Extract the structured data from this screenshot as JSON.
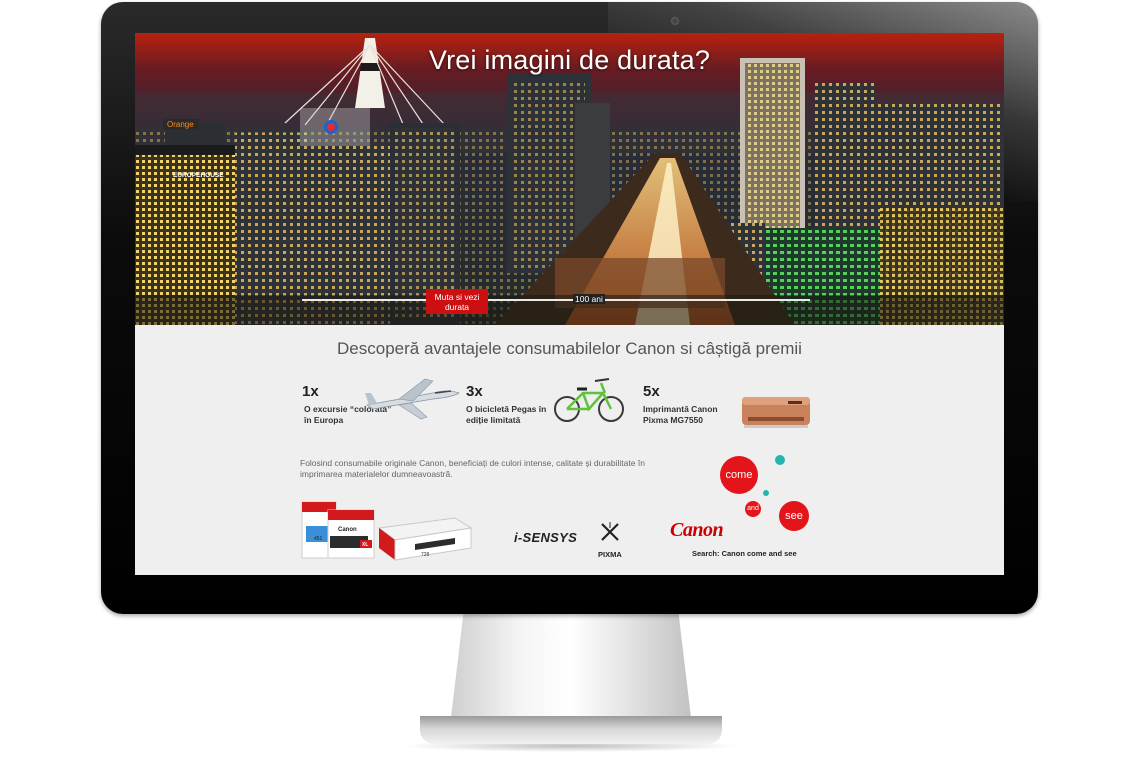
{
  "hero": {
    "title": "Vrei imagini de durata?",
    "slider_handle_label": "Muta si vezi durata",
    "slider_end_label": "100 ani",
    "sign_orange": "Orange",
    "sign_europe": "EUROPEHOUSE"
  },
  "promo": {
    "headline": "Descoperă avantajele consumabilelor Canon si câștigă premii",
    "prizes": [
      {
        "qty": "1x",
        "desc": "O excursie “colorată” în Europa"
      },
      {
        "qty": "3x",
        "desc": "O bicicletă Pegas în ediție limitată"
      },
      {
        "qty": "5x",
        "desc": "Imprimantă Canon Pixma MG7550"
      }
    ],
    "body": "Folosind consumabile originale Canon, beneficiați de culori intense, calitate și durabilitate în imprimarea materialelor dumneavoastră.",
    "brand_isensys": "i-SENSYS",
    "brand_pixma": "PIXMA",
    "cartridge_label_1": "Canon",
    "cartridge_label_2": "451",
    "cartridge_label_3": "XL",
    "toner_label": "728",
    "canon_logo": "Canon",
    "come_word": "come",
    "and_word": "and",
    "see_word": "see",
    "search_text": "Search: Canon come and see"
  },
  "colors": {
    "canon_red": "#cc1012",
    "teal_dot": "#23b5b2",
    "screen_bg": "#efefef"
  },
  "icons": [
    "airplane-icon",
    "bicycle-icon",
    "printer-icon",
    "ink-cartridge-icon",
    "toner-box-icon",
    "pixma-x-icon"
  ]
}
